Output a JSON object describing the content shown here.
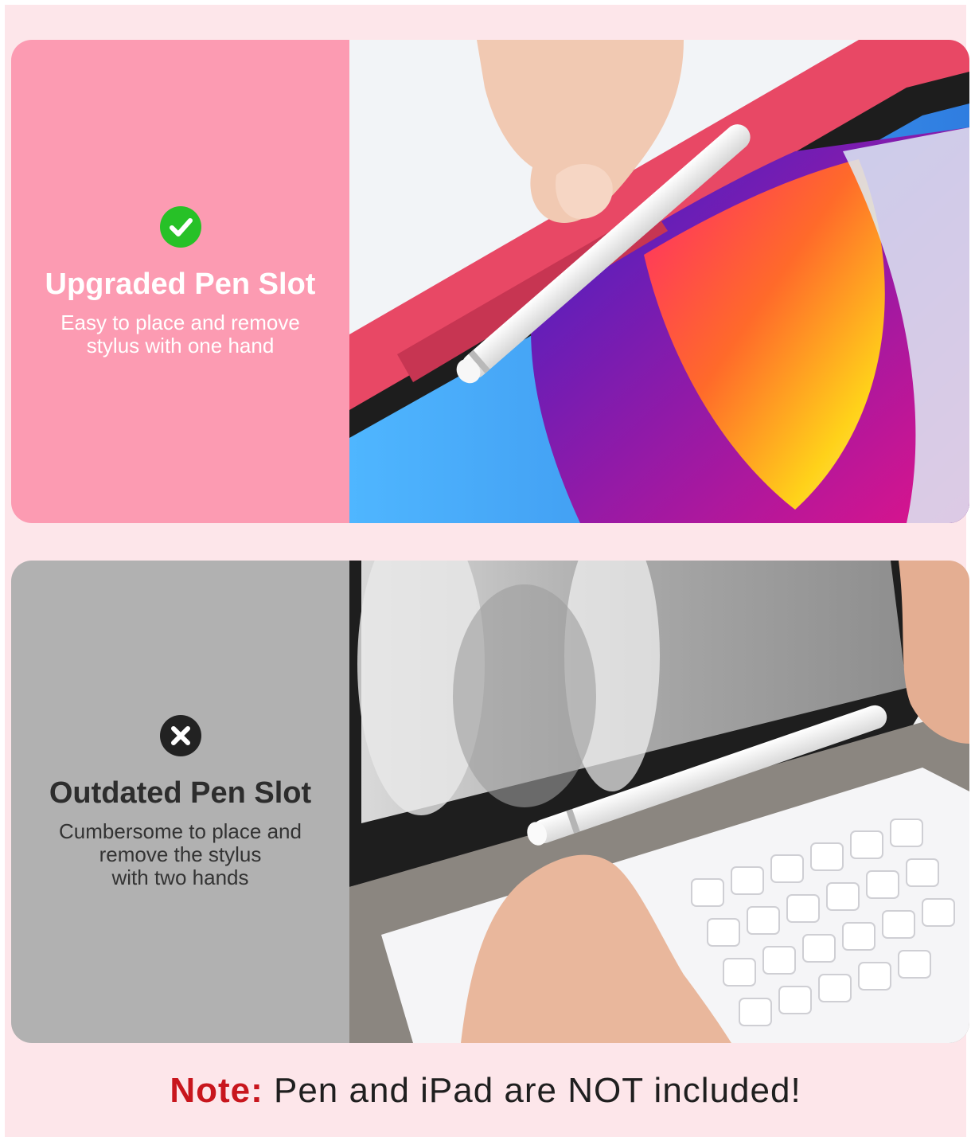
{
  "comparison": {
    "good": {
      "icon": "check-icon",
      "heading": "Upgraded Pen Slot",
      "description": "Easy to place and remove\nstylus with one hand",
      "accent_color": "#fc9bb2",
      "badge_color": "#27c127"
    },
    "bad": {
      "icon": "x-icon",
      "heading": "Outdated Pen Slot",
      "description": "Cumbersome to place and\nremove the stylus\nwith two hands",
      "accent_color": "#b1b1b1",
      "badge_color": "#222222"
    }
  },
  "note": {
    "label": "Note:",
    "text": "Pen and iPad are NOT included!",
    "label_color": "#c8161d"
  }
}
